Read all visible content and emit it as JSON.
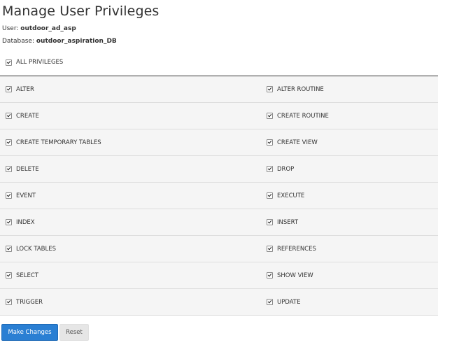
{
  "page": {
    "title": "Manage User Privileges",
    "user_label": "User:",
    "user_value": "outdoor_ad_asp",
    "db_label": "Database:",
    "db_value": "outdoor_aspiration_DB"
  },
  "all_privileges": {
    "label": "ALL PRIVILEGES",
    "checked": true
  },
  "privileges": [
    {
      "left": "ALTER",
      "right": "ALTER ROUTINE"
    },
    {
      "left": "CREATE",
      "right": "CREATE ROUTINE"
    },
    {
      "left": "CREATE TEMPORARY TABLES",
      "right": "CREATE VIEW"
    },
    {
      "left": "DELETE",
      "right": "DROP"
    },
    {
      "left": "EVENT",
      "right": "EXECUTE"
    },
    {
      "left": "INDEX",
      "right": "INSERT"
    },
    {
      "left": "LOCK TABLES",
      "right": "REFERENCES"
    },
    {
      "left": "SELECT",
      "right": "SHOW VIEW"
    },
    {
      "left": "TRIGGER",
      "right": "UPDATE"
    }
  ],
  "buttons": {
    "make_changes": "Make Changes",
    "reset": "Reset"
  },
  "colors": {
    "primary": "#2a7fd3",
    "row_bg": "#f5f5f5"
  }
}
